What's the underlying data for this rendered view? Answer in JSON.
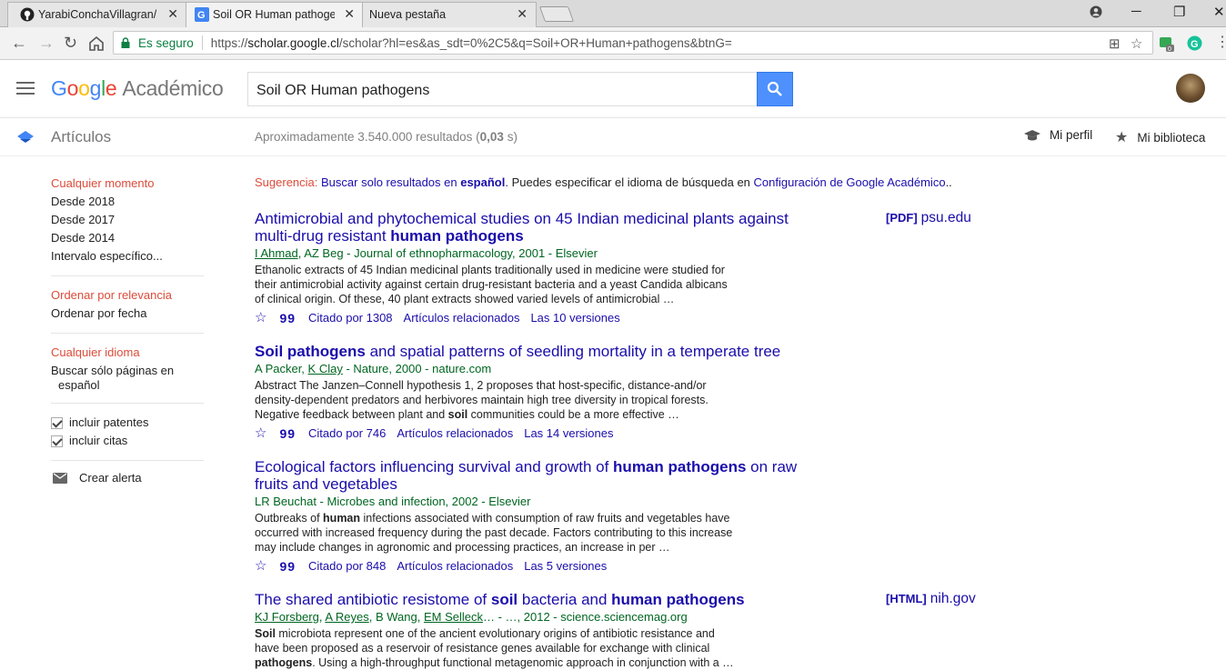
{
  "browser": {
    "tabs": [
      {
        "title": "YarabiConchaVillagran/Bi",
        "active": false
      },
      {
        "title": "Soil OR Human pathogen",
        "active": true
      },
      {
        "title": "Nueva pestaña",
        "active": false
      }
    ],
    "secure_label": "Es seguro",
    "url_prefix": "https://",
    "url_host": "scholar.google.cl",
    "url_path": "/scholar?hl=es&as_sdt=0%2C5&q=Soil+OR+Human+pathogens&btnG=",
    "extension_badge": "0"
  },
  "header": {
    "logo_google": "Google",
    "logo_product": "Académico",
    "search_value": "Soil OR Human pathogens"
  },
  "subheader": {
    "section_label": "Artículos",
    "result_count_prefix": "Aproximadamente 3.540.000 resultados (",
    "result_time": "0,03",
    "result_count_suffix": " s)",
    "profile_label": "Mi perfil",
    "library_label": "Mi biblioteca"
  },
  "sidebar": {
    "time_options": [
      "Cualquier momento",
      "Desde 2018",
      "Desde 2017",
      "Desde 2014",
      "Intervalo específico..."
    ],
    "sort_options": [
      "Ordenar por relevancia",
      "Ordenar por fecha"
    ],
    "lang_options": [
      "Cualquier idioma",
      "Buscar sólo páginas en",
      "español"
    ],
    "checkboxes": [
      "incluir patentes",
      "incluir citas"
    ],
    "alert_label": "Crear alerta"
  },
  "suggestion": {
    "label": "Sugerencia:",
    "link1_pre": "Buscar solo resultados en ",
    "link1_bold": "español",
    "middle": ". Puedes especificar el idioma de búsqueda en ",
    "link2": "Configuración de Google Académico",
    "end": ".."
  },
  "results": [
    {
      "title_pre": "Antimicrobial and phytochemical studies on 45 Indian medicinal plants against multi-drug resistant ",
      "title_bold": "human pathogens",
      "title_post": "",
      "authors_link": "I Ahmad",
      "authors_rest": ", AZ Beg - Journal of ethnopharmacology, 2001 - Elsevier",
      "snippet": "Ethanolic extracts of 45 Indian medicinal plants traditionally used in medicine were studied for their antimicrobial activity against certain drug-resistant bacteria and a yeast Candida albicans of clinical origin. Of these, 40 plant extracts showed varied levels of antimicrobial …",
      "cited": "Citado por 1308",
      "related": "Artículos relacionados",
      "versions": "Las 10 versiones",
      "side_type": "[PDF]",
      "side_host": "psu.edu"
    },
    {
      "title_pre": "",
      "title_bold": "Soil pathogens",
      "title_post": " and spatial patterns of seedling mortality in a temperate tree",
      "authors_pre": "A Packer, ",
      "authors_link": "K Clay",
      "authors_rest": " - Nature, 2000 - nature.com",
      "snippet_pre": "Abstract The Janzen–Connell hypothesis 1, 2 proposes that host-specific, distance-and/or density-dependent predators and herbivores maintain high tree diversity in tropical forests. Negative feedback between plant and ",
      "snippet_bold": "soil",
      "snippet_post": " communities could be a more effective …",
      "cited": "Citado por 746",
      "related": "Artículos relacionados",
      "versions": "Las 14 versiones"
    },
    {
      "title_pre": "Ecological factors influencing survival and growth of ",
      "title_bold": "human pathogens",
      "title_post": " on raw fruits and vegetables",
      "authors_rest": "LR Beuchat - Microbes and infection, 2002 - Elsevier",
      "snippet_pre": "Outbreaks of ",
      "snippet_bold": "human",
      "snippet_post": " infections associated with consumption of raw fruits and vegetables have occurred with increased frequency during the past decade. Factors contributing to this increase may include changes in agronomic and processing practices, an increase in per …",
      "cited": "Citado por 848",
      "related": "Artículos relacionados",
      "versions": "Las 5 versiones"
    },
    {
      "title_pre": "The shared antibiotic resistome of ",
      "title_bold": "soil",
      "title_mid": " bacteria and ",
      "title_bold2": "human pathogens",
      "authors_link": "KJ Forsberg",
      "authors_sep1": ", ",
      "authors_link2": "A Reyes",
      "authors_sep2": ", B Wang, ",
      "authors_link3": "EM Selleck",
      "authors_rest": "… - …, 2012 - science.sciencemag.org",
      "snippet_bold": "Soil",
      "snippet_mid": " microbiota represent one of the ancient evolutionary origins of antibiotic resistance and have been proposed as a reservoir of resistance genes available for exchange with clinical ",
      "snippet_bold2": "pathogens",
      "snippet_post": ". Using a high-throughput functional metagenomic approach in conjunction with a …",
      "side_type": "[HTML]",
      "side_host": "nih.gov"
    }
  ],
  "colors": {
    "link": "#1a0dab",
    "green": "#006621",
    "red": "#dd4b39",
    "search_blue": "#4d90fe"
  }
}
